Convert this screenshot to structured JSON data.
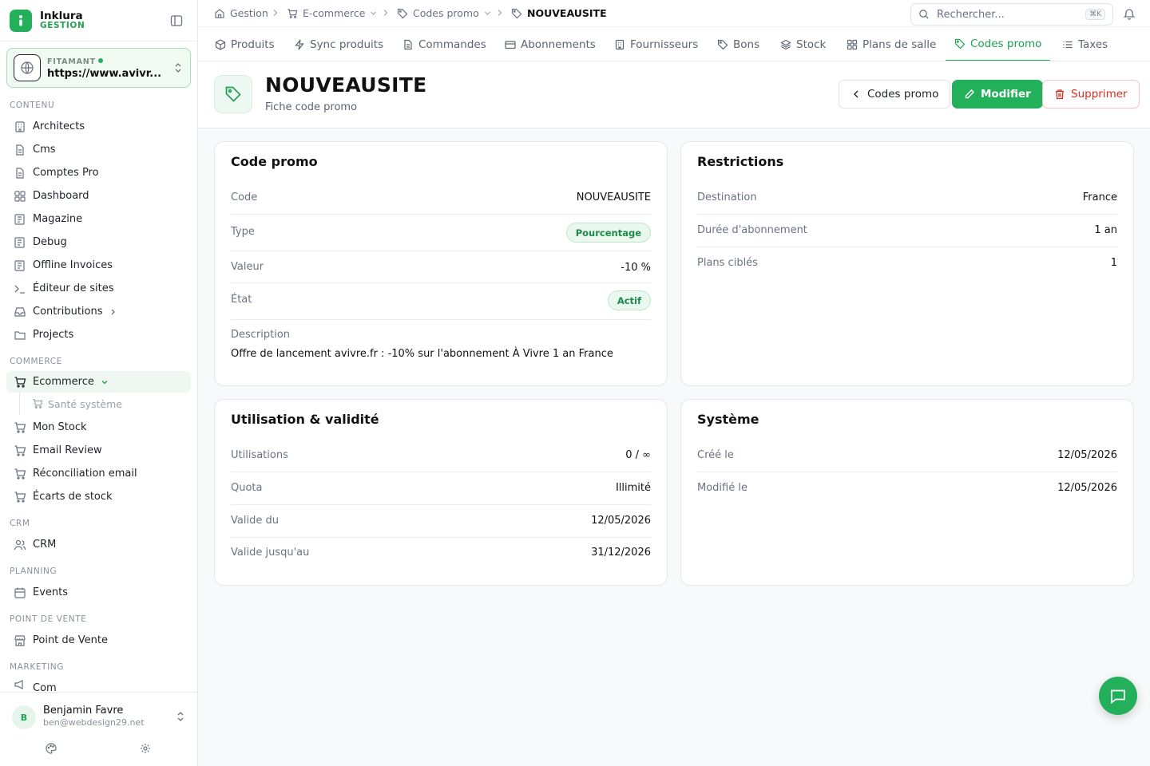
{
  "brand": {
    "name": "Inklura",
    "sub": "GESTION"
  },
  "site": {
    "label": "FITAMANT",
    "url": "https://www.avivr..."
  },
  "sidebar": {
    "sections": {
      "contenu": "CONTENU",
      "commerce": "COMMERCE",
      "crm": "CRM",
      "planning": "PLANNING",
      "pdv": "POINT DE VENTE",
      "marketing": "MARKETING"
    },
    "items": {
      "architects": "Architects",
      "cms": "Cms",
      "comptes_pro": "Comptes Pro",
      "dashboard": "Dashboard",
      "magazine": "Magazine",
      "debug": "Debug",
      "offline_invoices": "Offline Invoices",
      "editeur": "Éditeur de sites",
      "contributions": "Contributions",
      "projects": "Projects",
      "ecommerce": "Ecommerce",
      "sante": "Santé système",
      "mon_stock": "Mon Stock",
      "email_review": "Email Review",
      "reconciliation": "Réconciliation email",
      "ecarts": "Écarts de stock",
      "crm": "CRM",
      "events": "Events",
      "pdv": "Point de Vente",
      "com": "Com"
    }
  },
  "user": {
    "initial": "B",
    "name": "Benjamin Favre",
    "email": "ben@webdesign29.net"
  },
  "breadcrumb": {
    "gestion": "Gestion",
    "ecommerce": "E-commerce",
    "codes_promo": "Codes promo",
    "current": "NOUVEAUSITE"
  },
  "search": {
    "placeholder": "Rechercher...",
    "shortcut": "⌘K"
  },
  "tabs": {
    "produits": "Produits",
    "sync": "Sync produits",
    "commandes": "Commandes",
    "abonnements": "Abonnements",
    "fournisseurs": "Fournisseurs",
    "bons": "Bons",
    "stock": "Stock",
    "plans": "Plans de salle",
    "codes_promo": "Codes promo",
    "taxes": "Taxes"
  },
  "page": {
    "title": "NOUVEAUSITE",
    "subtitle": "Fiche code promo",
    "back_label": "Codes promo",
    "edit_label": "Modifier",
    "delete_label": "Supprimer"
  },
  "promo": {
    "title": "Code promo",
    "code_label": "Code",
    "code": "NOUVEAUSITE",
    "type_label": "Type",
    "type": "Pourcentage",
    "value_label": "Valeur",
    "value": "-10 %",
    "state_label": "État",
    "state": "Actif",
    "desc_label": "Description",
    "desc": "Offre de lancement avivre.fr : -10% sur l'abonnement À Vivre 1 an France"
  },
  "restrictions": {
    "title": "Restrictions",
    "dest_label": "Destination",
    "dest": "France",
    "duration_label": "Durée d'abonnement",
    "duration": "1 an",
    "plans_label": "Plans ciblés",
    "plans": "1"
  },
  "usage": {
    "title": "Utilisation & validité",
    "uses_label": "Utilisations",
    "uses": "0 / ∞",
    "quota_label": "Quota",
    "quota": "Illimité",
    "from_label": "Valide du",
    "from": "12/05/2026",
    "to_label": "Valide jusqu'au",
    "to": "31/12/2026"
  },
  "system": {
    "title": "Système",
    "created_label": "Créé le",
    "created": "12/05/2026",
    "modified_label": "Modifié le",
    "modified": "12/05/2026"
  },
  "colors": {
    "accent": "#22b05a",
    "danger": "#d92d20"
  }
}
